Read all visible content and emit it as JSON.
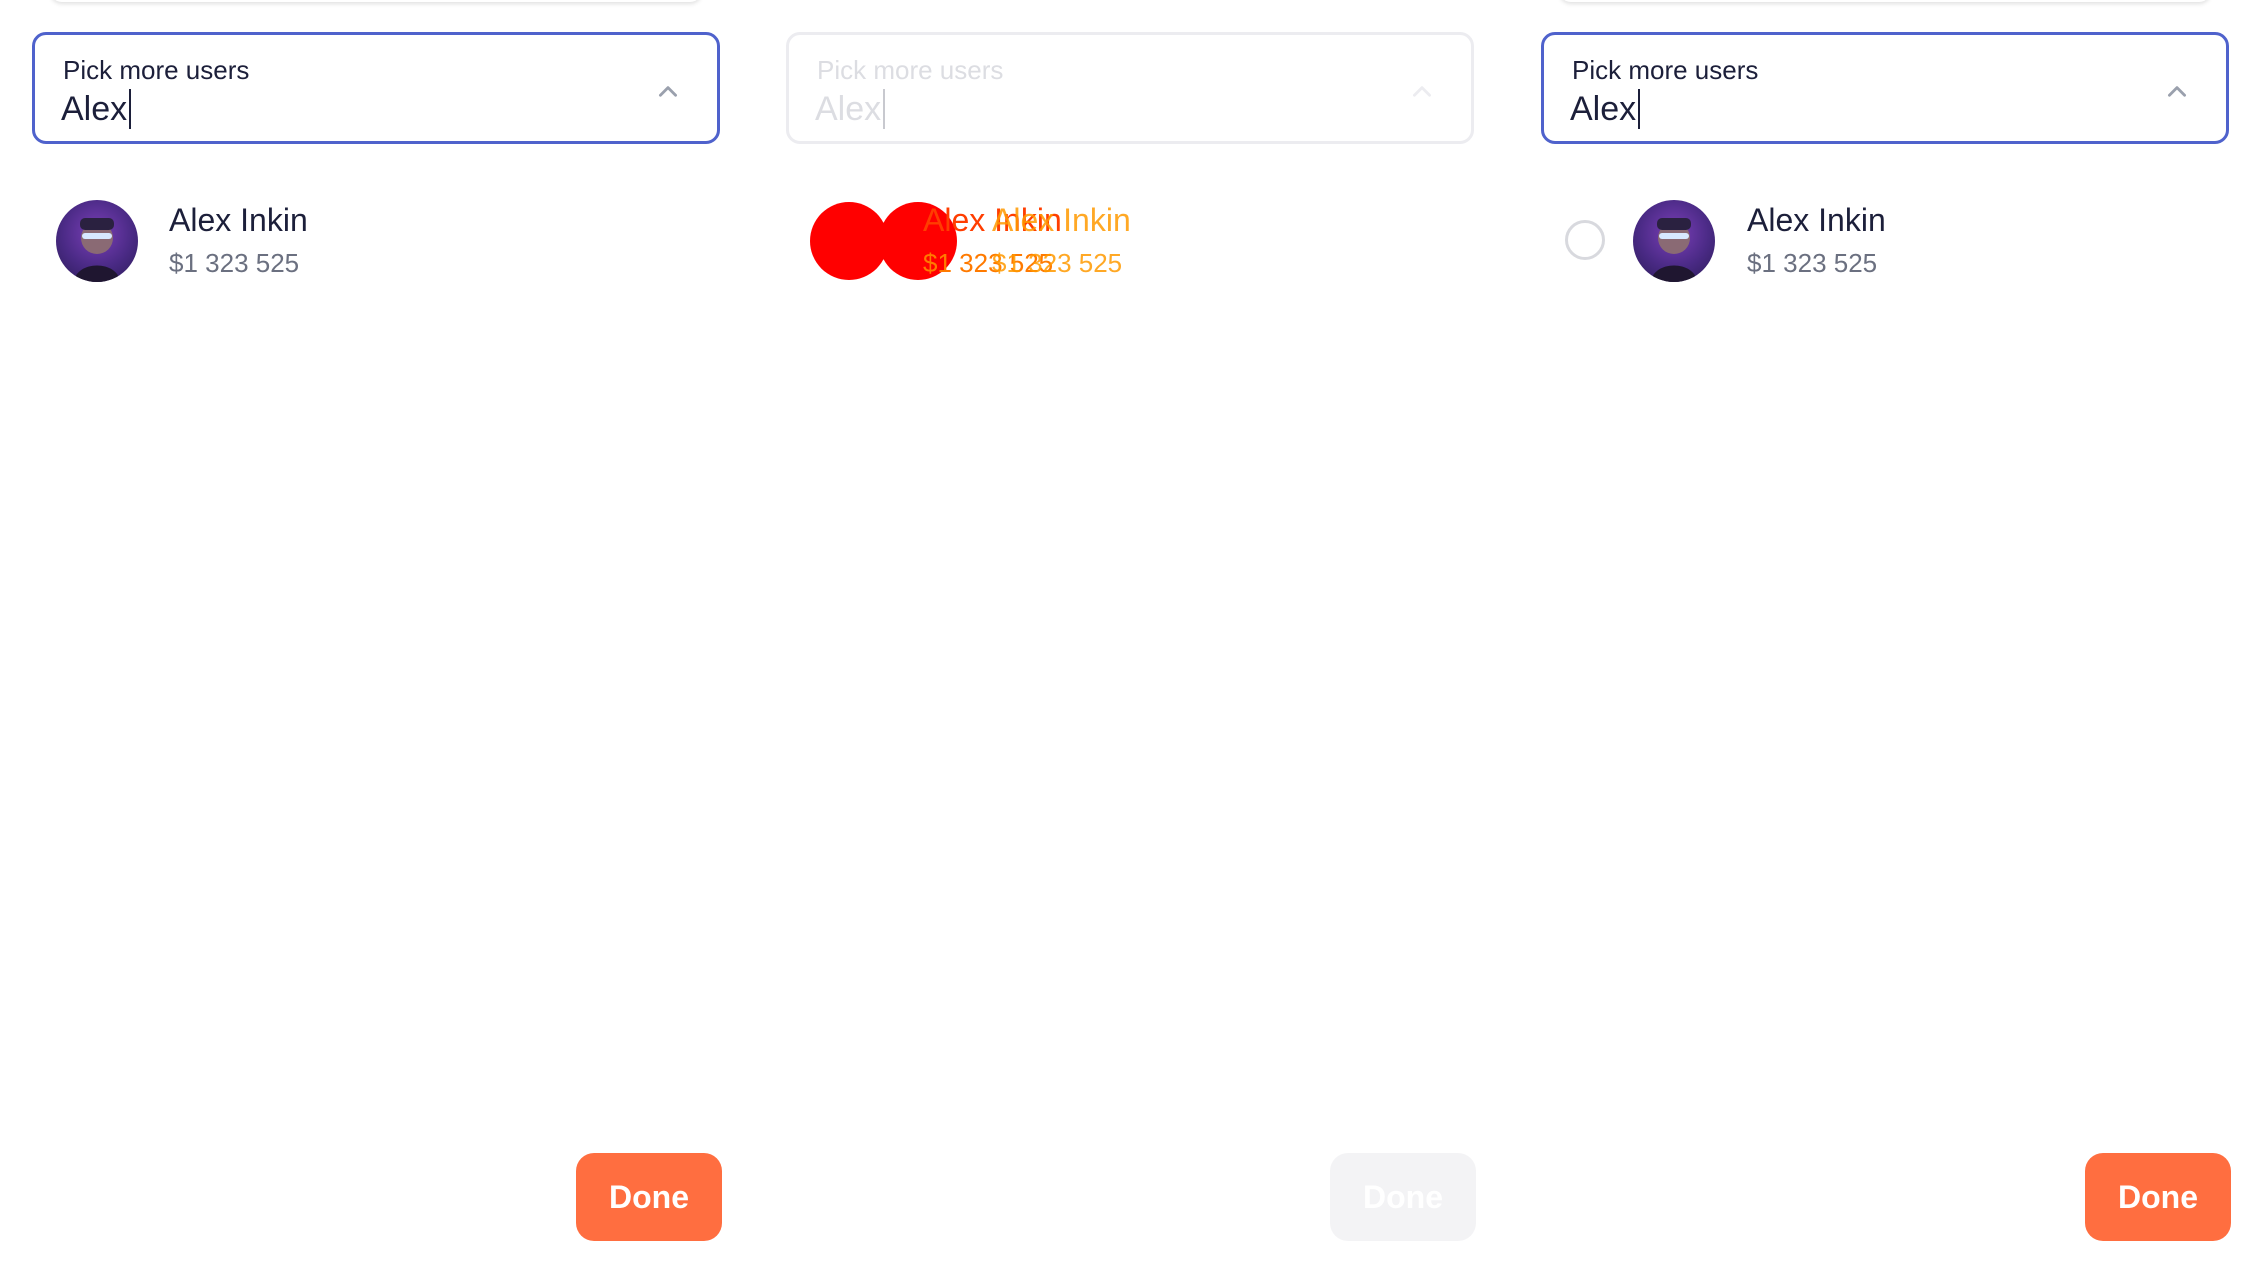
{
  "panels": [
    {
      "field_label": "Pick more users",
      "search_value": "Alex",
      "result": {
        "name": "Alex Inkin",
        "amount": "$1 323 525"
      },
      "done_label": "Done"
    },
    {
      "field_label": "Pick more users",
      "search_value": "Alex",
      "result": {
        "name": "Alex Inkin",
        "amount": "$1 323 525"
      },
      "done_label": "Done"
    },
    {
      "field_label": "Pick more users",
      "search_value": "Alex",
      "result": {
        "name": "Alex Inkin",
        "amount": "$1 323 525"
      },
      "done_label": "Done"
    }
  ],
  "icons": {
    "dropdown": "chevron-up-icon",
    "avatar": "user-avatar"
  },
  "colors": {
    "accent": "#4f62cc",
    "done": "#ff6e40",
    "disabled": "#f3f3f5"
  }
}
